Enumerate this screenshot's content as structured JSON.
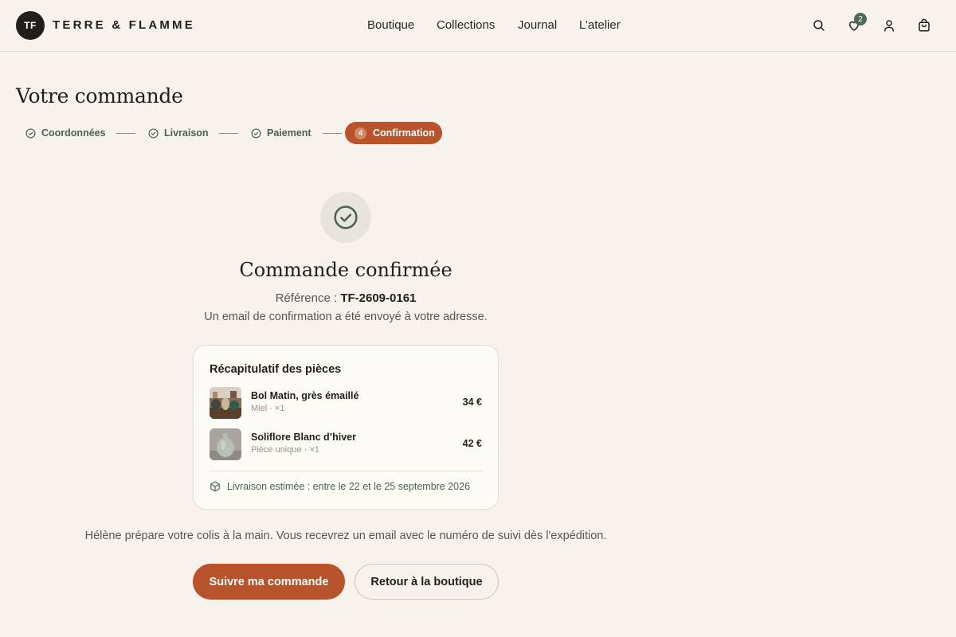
{
  "brand": {
    "initials": "TF",
    "name": "TERRE & FLAMME"
  },
  "nav": [
    "Boutique",
    "Collections",
    "Journal",
    "L’atelier"
  ],
  "header": {
    "wishlist_count": "2"
  },
  "page": {
    "title": "Votre commande"
  },
  "steps": {
    "completed": [
      "Coordonnées",
      "Livraison",
      "Paiement"
    ],
    "active": {
      "number": "4",
      "label": "Confirmation"
    }
  },
  "confirmation": {
    "title": "Commande confirmée",
    "reference_label": "Référence :",
    "reference": "TF-2609-0161",
    "email_note": "Un email de confirmation a été envoyé à votre adresse."
  },
  "summary": {
    "title": "Récapitulatif des pièces",
    "items": [
      {
        "name": "Bol Matin, grès émaillé",
        "meta": "Miel · ×1",
        "price": "34 €"
      },
      {
        "name": "Soliflore Blanc d’hiver",
        "meta": "Pièce unique · ×1",
        "price": "42 €"
      }
    ],
    "delivery": "Livraison estimée : entre le 22 et le 25 septembre 2026"
  },
  "prep_note": "Hélène prépare votre colis à la main. Vous recevrez un email avec le numéro de suivi dès l'expédition.",
  "actions": {
    "track": "Suivre ma commande",
    "back": "Retour à la boutique"
  },
  "colors": {
    "accent": "#b9532c",
    "green": "#4a6352",
    "background": "#f8f2ec"
  }
}
